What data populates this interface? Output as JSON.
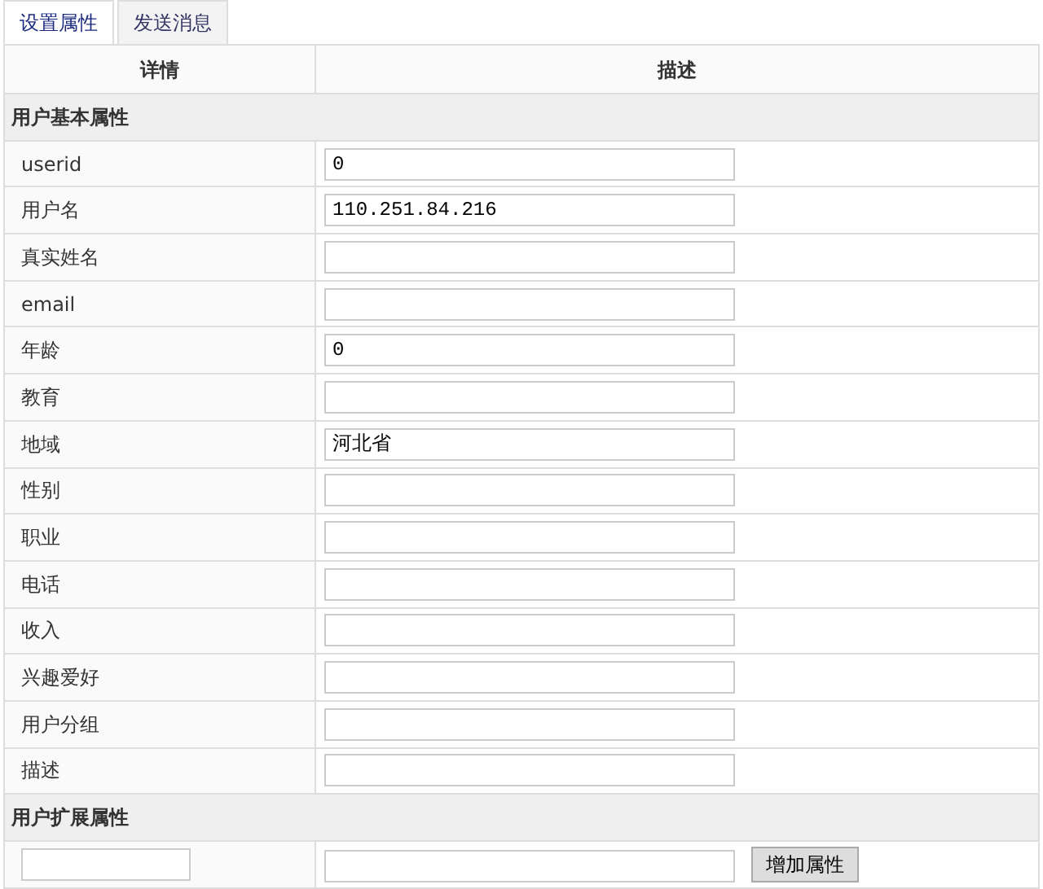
{
  "tabs": [
    {
      "label": "设置属性",
      "selected": true
    },
    {
      "label": "发送消息",
      "selected": false
    }
  ],
  "table": {
    "columns": [
      "详情",
      "描述"
    ],
    "sections": [
      {
        "title": "用户基本属性",
        "rows": [
          {
            "label": "userid",
            "value": "0"
          },
          {
            "label": "用户名",
            "value": "110.251.84.216"
          },
          {
            "label": "真实姓名"
          },
          {
            "label": "email"
          },
          {
            "label": "年龄",
            "value": "0"
          },
          {
            "label": "教育"
          },
          {
            "label": "地域",
            "value": "河北省"
          },
          {
            "label": "性别"
          },
          {
            "label": "职业"
          },
          {
            "label": "电话"
          },
          {
            "label": "收入"
          },
          {
            "label": "兴趣爱好"
          },
          {
            "label": "用户分组"
          },
          {
            "label": "描述"
          }
        ]
      },
      {
        "title": "用户扩展属性",
        "add_button": "增加属性"
      }
    ]
  }
}
